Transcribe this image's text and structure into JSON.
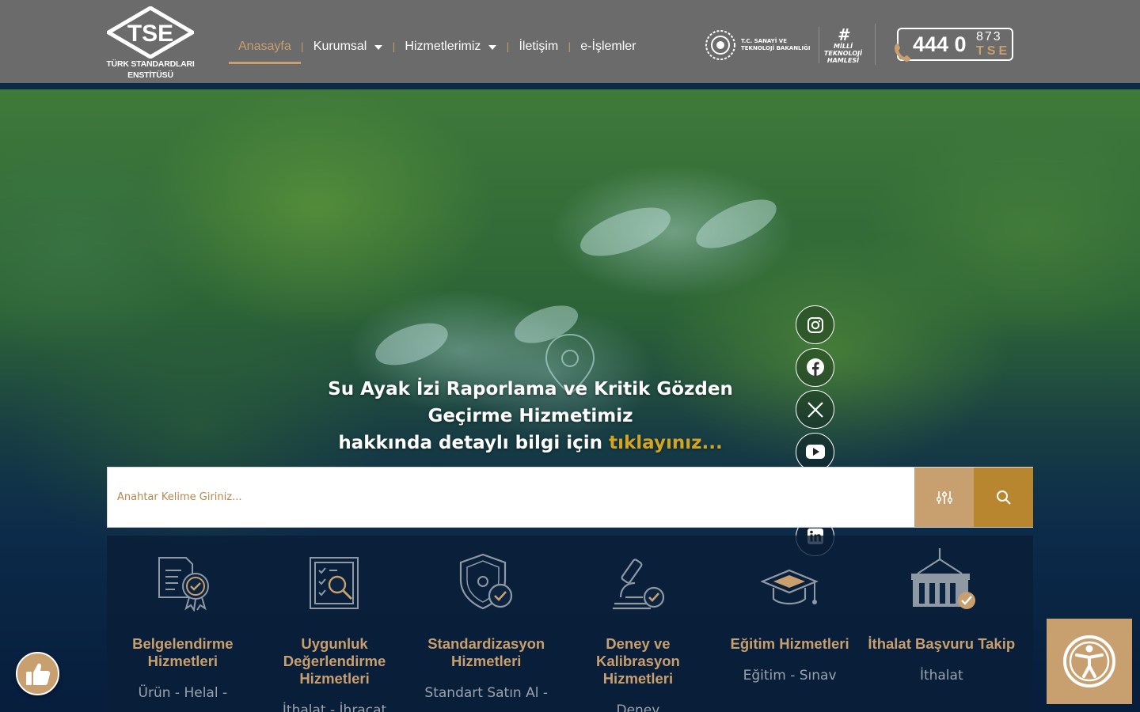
{
  "header": {
    "logo_text_line1": "TÜRK STANDARDLARI",
    "logo_text_line2": "ENSTİTÜSÜ",
    "logo_letters": "TSE",
    "nav": [
      {
        "label": "Anasayfa",
        "active": true
      },
      {
        "label": "Kurumsal",
        "dropdown": true
      },
      {
        "label": "Hizmetlerimiz",
        "dropdown": true
      },
      {
        "label": "İletişim"
      },
      {
        "label": "e-İşlemler"
      }
    ],
    "ministry_line1": "T.C. SANAYİ VE",
    "ministry_line2": "TEKNOLOJİ BAKANLIĞI",
    "milli_line1": "MİLLİ",
    "milli_line2": "TEKNOLOJİ",
    "milli_line3": "HAMLESİ",
    "phone_main": "444 0",
    "phone_top": "873",
    "phone_bottom": "TSE"
  },
  "hero": {
    "title_line1": "Su Ayak İzi Raporlama ve Kritik Gözden Geçirme Hizmetimiz",
    "title_line2_prefix": "hakkında detaylı bilgi için",
    "title_link": "tıklayınız..."
  },
  "social": [
    "instagram-icon",
    "facebook-icon",
    "x-icon",
    "youtube-icon",
    "viber-icon",
    "linkedin-icon"
  ],
  "search": {
    "placeholder": "Anahtar Kelime Giriniz..."
  },
  "services": [
    {
      "title": "Belgelendirme Hizmetleri",
      "sub": "Ürün - Helal -",
      "icon": "certificate-icon"
    },
    {
      "title": "Uygunluk Değerlendirme Hizmetleri",
      "sub": "İthalat - İhracat",
      "icon": "inspection-icon"
    },
    {
      "title": "Standardizasyon Hizmetleri",
      "sub": "Standart Satın Al -",
      "icon": "shield-check-icon"
    },
    {
      "title": "Deney ve Kalibrasyon Hizmetleri",
      "sub": "Deney",
      "icon": "microscope-icon"
    },
    {
      "title": "Eğitim Hizmetleri",
      "sub": "Eğitim - Sınav",
      "icon": "graduation-cap-icon"
    },
    {
      "title": "İthalat Başvuru Takip",
      "sub": "İthalat",
      "icon": "container-icon"
    }
  ],
  "colors": {
    "accent": "#c89f6e",
    "gold": "#b8862e",
    "link": "#d4a520",
    "header_bg": "#6b6b6b"
  }
}
